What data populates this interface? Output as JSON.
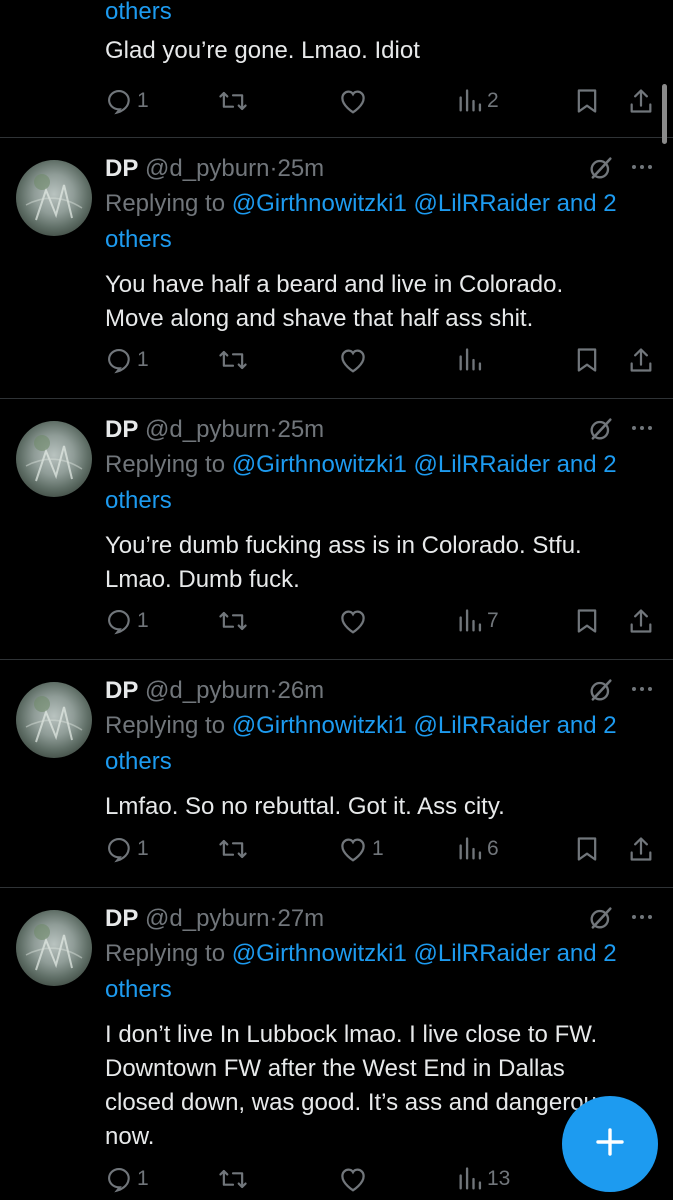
{
  "colors": {
    "background": "#000000",
    "text": "#e7e9ea",
    "muted": "#71767b",
    "accent": "#1d9bf0",
    "divider": "#2f3336"
  },
  "top_partial": {
    "reply_tail": "others",
    "text": "Glad you’re gone. Lmao.  Idiot",
    "stats": {
      "replies": "1",
      "reposts": "",
      "likes": "",
      "views": "2"
    }
  },
  "tweets": [
    {
      "name": "DP",
      "handle": "@d_pyburn",
      "sep": "·",
      "time": "25m",
      "replying_prefix": "Replying to ",
      "replying_mentions": "@Girthnowitzki1 @LilRRaider and 2",
      "replying_others": "others",
      "text_lines": [
        "You have half a beard and live in Colorado.",
        "Move along and shave that half ass shit."
      ],
      "stats": {
        "replies": "1",
        "reposts": "",
        "likes": "",
        "views": ""
      }
    },
    {
      "name": "DP",
      "handle": "@d_pyburn",
      "sep": "·",
      "time": "25m",
      "replying_prefix": "Replying to ",
      "replying_mentions": "@Girthnowitzki1 @LilRRaider and 2",
      "replying_others": "others",
      "text_lines": [
        "You’re dumb fucking ass is in Colorado.  Stfu.",
        "Lmao.  Dumb fuck."
      ],
      "stats": {
        "replies": "1",
        "reposts": "",
        "likes": "",
        "views": "7"
      }
    },
    {
      "name": "DP",
      "handle": "@d_pyburn",
      "sep": "·",
      "time": "26m",
      "replying_prefix": "Replying to ",
      "replying_mentions": "@Girthnowitzki1 @LilRRaider and 2",
      "replying_others": "others",
      "text_lines": [
        "Lmfao. So no rebuttal.  Got it.  Ass city."
      ],
      "stats": {
        "replies": "1",
        "reposts": "",
        "likes": "1",
        "views": "6"
      }
    },
    {
      "name": "DP",
      "handle": "@d_pyburn",
      "sep": "·",
      "time": "27m",
      "replying_prefix": "Replying to ",
      "replying_mentions": "@Girthnowitzki1 @LilRRaider and 2",
      "replying_others": "others",
      "text_lines": [
        "I don’t live In Lubbock lmao.  I live close to FW.",
        "Downtown FW after the West End in Dallas",
        "closed down, was good. It’s ass and dangerous",
        "now."
      ],
      "stats": {
        "replies": "1",
        "reposts": "",
        "likes": "",
        "views": "13"
      }
    }
  ],
  "icons": {
    "reply": "speech-bubble-icon",
    "repost": "repost-arrows-icon",
    "like": "heart-icon",
    "views": "bar-chart-icon",
    "bookmark": "bookmark-icon",
    "share": "share-upload-icon",
    "grok": "grok-slash-circle-icon",
    "more": "more-dots-icon",
    "compose": "plus-icon"
  }
}
